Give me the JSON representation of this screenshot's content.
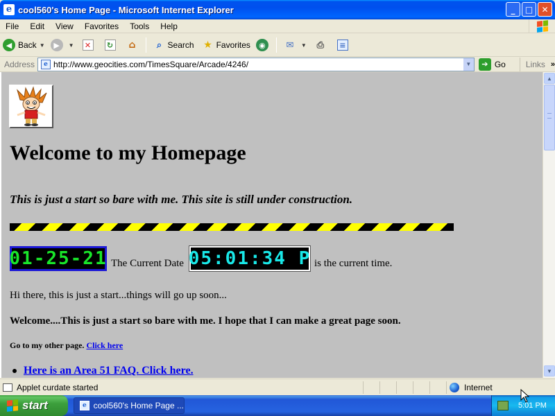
{
  "window": {
    "title": "cool560's Home Page - Microsoft Internet Explorer",
    "buttons": {
      "minimize": "_",
      "maximize": "□",
      "close": "✕"
    }
  },
  "menu": {
    "items": [
      "File",
      "Edit",
      "View",
      "Favorites",
      "Tools",
      "Help"
    ]
  },
  "toolbar": {
    "back": "Back",
    "search": "Search",
    "favorites": "Favorites"
  },
  "address": {
    "label": "Address",
    "url": "http://www.geocities.com/TimesSquare/Arcade/4246/",
    "go": "Go",
    "links": "Links"
  },
  "page": {
    "title": "Welcome to my Homepage",
    "subtitle": "This is just a start so bare with me. This site is still under construction.",
    "date_display": "01-25-21",
    "date_label": "The Current Date",
    "time_display": "05:01:34 P",
    "time_label": "is the current time.",
    "intro": "Hi there, this is just a start...things will go up soon...",
    "welcome": "Welcome....This is just a start so bare with me. I hope that I can make a great page soon.",
    "other_page_text": "Go to my other page.",
    "other_page_link": "Click here",
    "faq_link": "Here is an Area 51 FAQ. Click here."
  },
  "status": {
    "text": "Applet curdate started",
    "zone": "Internet"
  },
  "taskbar": {
    "start": "start",
    "task": "cool560's Home Page ...",
    "clock": "5:01 PM"
  },
  "colors": {
    "page_background": "#c0c0c0",
    "link": "#0000ee",
    "date_lcd": "#19e62a",
    "time_lcd": "#19e8e8",
    "hazard_yellow": "#ffff00"
  }
}
